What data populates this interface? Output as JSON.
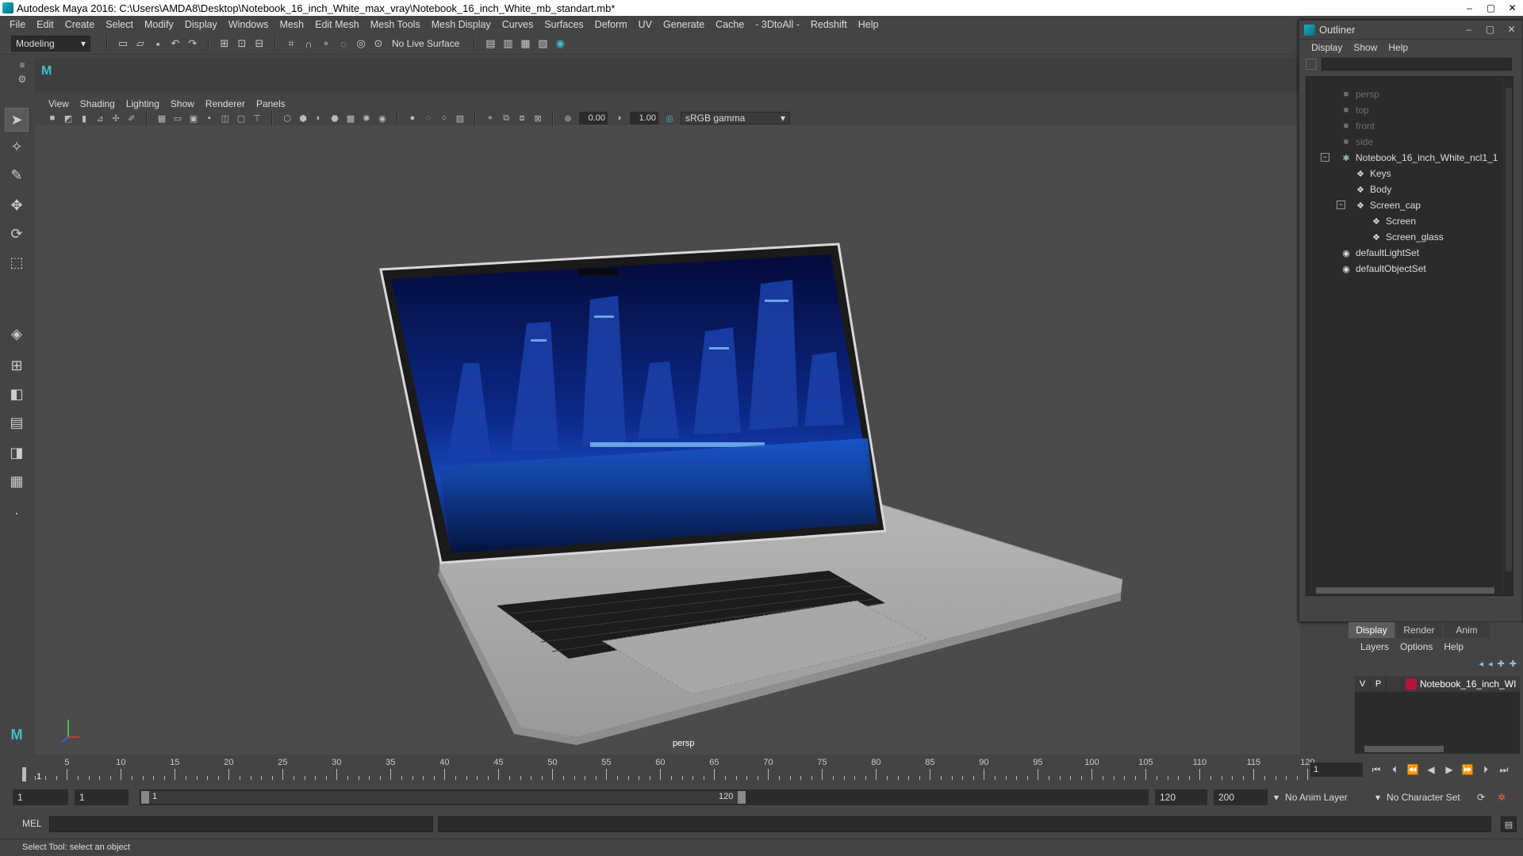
{
  "window": {
    "title": "Autodesk Maya 2016: C:\\Users\\AMDA8\\Desktop\\Notebook_16_inch_White_max_vray\\Notebook_16_inch_White_mb_standart.mb*",
    "minimize": "–",
    "maximize": "▢",
    "close": "✕"
  },
  "menubar": {
    "items": [
      "File",
      "Edit",
      "Create",
      "Select",
      "Modify",
      "Display",
      "Windows",
      "Mesh",
      "Edit Mesh",
      "Mesh Tools",
      "Mesh Display",
      "Curves",
      "Surfaces",
      "Deform",
      "UV",
      "Generate",
      "Cache",
      "- 3DtoAll -",
      "Redshift",
      "Help"
    ]
  },
  "statusline": {
    "mode": "Modeling",
    "live_surface": "No Live Surface"
  },
  "panel": {
    "menu": [
      "View",
      "Shading",
      "Lighting",
      "Show",
      "Renderer",
      "Panels"
    ],
    "near_value": "0.00",
    "far_value": "1.00",
    "color_space": "sRGB gamma",
    "camera_label": "persp"
  },
  "outliner": {
    "title": "Outliner",
    "menu": [
      "Display",
      "Show",
      "Help"
    ],
    "items": [
      {
        "label": "persp",
        "icon": "camera-icon",
        "dim": true
      },
      {
        "label": "top",
        "icon": "camera-icon",
        "dim": true
      },
      {
        "label": "front",
        "icon": "camera-icon",
        "dim": true
      },
      {
        "label": "side",
        "icon": "camera-icon",
        "dim": true
      },
      {
        "label": "Notebook_16_inch_White_ncl1_1",
        "icon": "group-icon",
        "dim": false
      },
      {
        "label": "Keys",
        "icon": "mesh-icon",
        "dim": false
      },
      {
        "label": "Body",
        "icon": "mesh-icon",
        "dim": false
      },
      {
        "label": "Screen_cap",
        "icon": "mesh-icon",
        "dim": false
      },
      {
        "label": "Screen",
        "icon": "mesh-icon",
        "dim": false
      },
      {
        "label": "Screen_glass",
        "icon": "mesh-icon",
        "dim": false
      },
      {
        "label": "defaultLightSet",
        "icon": "set-icon",
        "dim": false
      },
      {
        "label": "defaultObjectSet",
        "icon": "set-icon",
        "dim": false
      }
    ]
  },
  "layer_editor": {
    "tabs": [
      "Display",
      "Render",
      "Anim"
    ],
    "menu": [
      "Layers",
      "Options",
      "Help"
    ],
    "layer": {
      "v": "V",
      "p": "P",
      "name": "Notebook_16_inch_WI",
      "color": "#b3153a"
    }
  },
  "timeslider": {
    "ticks": [
      "5",
      "10",
      "15",
      "20",
      "25",
      "30",
      "35",
      "40",
      "45",
      "50",
      "55",
      "60",
      "65",
      "70",
      "75",
      "80",
      "85",
      "90",
      "95",
      "100",
      "105",
      "110",
      "115",
      "120"
    ],
    "current": "1",
    "frame_field": "1"
  },
  "rangeslider": {
    "start_field": "1",
    "start_field2": "1",
    "bar_start": "1",
    "bar_end": "120",
    "end_field": "120",
    "end_field2": "200",
    "anim_layer": "No Anim Layer",
    "character_set": "No Character Set"
  },
  "cmdline": {
    "label": "MEL"
  },
  "helpline": {
    "text": "Select Tool: select an object"
  },
  "colors": {
    "accent": "#3fc0c8",
    "viewport_bg": "#4b4b4b",
    "layer_color": "#b3153a"
  }
}
